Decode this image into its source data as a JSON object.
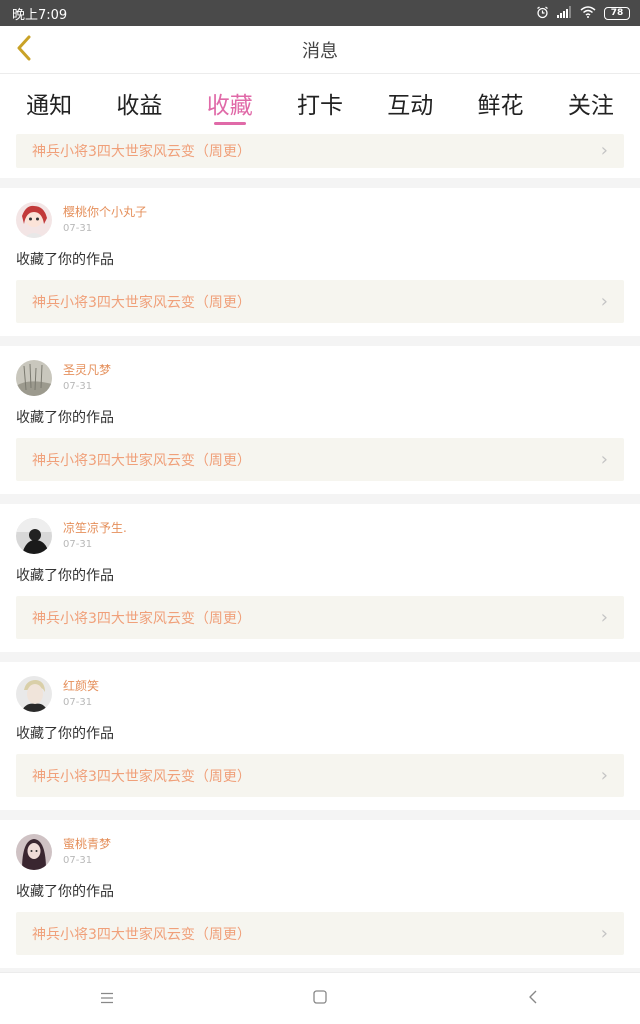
{
  "status_bar": {
    "time": "晚上7:09",
    "battery": "78"
  },
  "header": {
    "title": "消息"
  },
  "tabs": [
    {
      "label": "通知"
    },
    {
      "label": "收益"
    },
    {
      "label": "收藏"
    },
    {
      "label": "打卡"
    },
    {
      "label": "互动"
    },
    {
      "label": "鲜花"
    },
    {
      "label": "关注"
    }
  ],
  "active_tab": "收藏",
  "partial_item": {
    "work_title": "神兵小将3四大世家风云变（周更）"
  },
  "items": [
    {
      "username": "樱桃你个小丸子",
      "time": "07-31",
      "action": "收藏了你的作品",
      "work_title": "神兵小将3四大世家风云变（周更）"
    },
    {
      "username": "圣灵凡梦",
      "time": "07-31",
      "action": "收藏了你的作品",
      "work_title": "神兵小将3四大世家风云变（周更）"
    },
    {
      "username": "凉笙凉予生.",
      "time": "07-31",
      "action": "收藏了你的作品",
      "work_title": "神兵小将3四大世家风云变（周更）"
    },
    {
      "username": "红颜笑",
      "time": "07-31",
      "action": "收藏了你的作品",
      "work_title": "神兵小将3四大世家风云变（周更）"
    },
    {
      "username": "蜜桃青梦",
      "time": "07-31",
      "action": "收藏了你的作品",
      "work_title": "神兵小将3四大世家风云变（周更）"
    }
  ],
  "colors": {
    "accent": "#e06aa8",
    "username": "#e5905c",
    "work_title": "#f0a07a",
    "back_arrow": "#c9a227"
  }
}
